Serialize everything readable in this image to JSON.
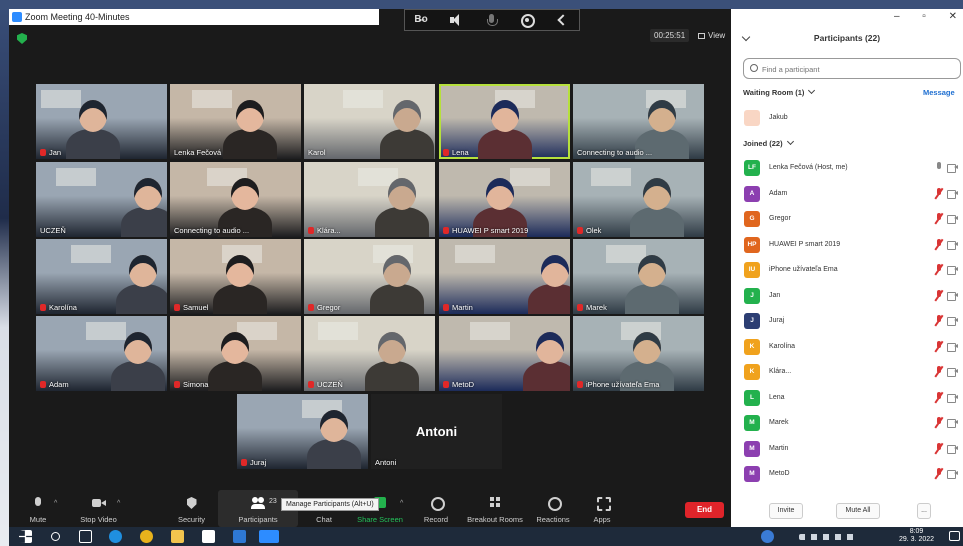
{
  "window": {
    "title": "Zoom Meeting 40-Minutes"
  },
  "meeting": {
    "timer": "00:25:51",
    "view_label": "View"
  },
  "audio_bar": {
    "items": [
      "Bo",
      "speaker",
      "mic",
      "broadcast",
      "back"
    ]
  },
  "tiles": [
    {
      "name": "Jan",
      "muted": true
    },
    {
      "name": "Lenka Fečová",
      "muted": false
    },
    {
      "name": "Karol",
      "muted": false
    },
    {
      "name": "Lena",
      "muted": true,
      "active": true
    },
    {
      "name": "Connecting to audio ...",
      "muted": false
    },
    {
      "name": "UCZEŇ",
      "muted": false
    },
    {
      "name": "Connecting to audio ...",
      "muted": false
    },
    {
      "name": "Klára...",
      "muted": true
    },
    {
      "name": "HUAWEI P smart 2019",
      "muted": true
    },
    {
      "name": "Olek",
      "muted": true
    },
    {
      "name": "Karolína",
      "muted": true
    },
    {
      "name": "Samuel",
      "muted": true
    },
    {
      "name": "Gregor",
      "muted": true
    },
    {
      "name": "Martin",
      "muted": true
    },
    {
      "name": "Marek",
      "muted": true
    },
    {
      "name": "Adam",
      "muted": true
    },
    {
      "name": "Simona",
      "muted": true
    },
    {
      "name": "UCZEŇ",
      "muted": true
    },
    {
      "name": "MetoD",
      "muted": true
    },
    {
      "name": "iPhone užívateľa Ema",
      "muted": true
    },
    {
      "name": "Juraj",
      "muted": true
    },
    {
      "name": "Antoni",
      "muted": false,
      "big": "Antoni"
    }
  ],
  "toolbar": {
    "mute": "Mute",
    "stop_video": "Stop Video",
    "security": "Security",
    "participants": "Participants",
    "participants_count": "23",
    "tooltip": "Manage Participants (Alt+U)",
    "chat": "Chat",
    "share_screen": "Share Screen",
    "record": "Record",
    "breakout": "Breakout Rooms",
    "reactions": "Reactions",
    "apps": "Apps",
    "end": "End"
  },
  "panel": {
    "title": "Participants (22)",
    "search_placeholder": "Find a participant",
    "waiting_header": "Waiting Room (1)",
    "message_link": "Message",
    "waiting": [
      {
        "name": "Jakub",
        "color": "#f9d6c4"
      }
    ],
    "joined_header": "Joined (22)",
    "joined": [
      {
        "initials": "LF",
        "name": "Lenka Fečová (Host, me)",
        "color": "#23b14d",
        "muted": false
      },
      {
        "initials": "A",
        "name": "Adam",
        "color": "#8c3fb0",
        "muted": true
      },
      {
        "initials": "G",
        "name": "Gregor",
        "color": "#e0661e",
        "muted": true
      },
      {
        "initials": "HP",
        "name": "HUAWEI P smart 2019",
        "color": "#e0661e",
        "muted": true
      },
      {
        "initials": "IU",
        "name": "iPhone užívateľa Ema",
        "color": "#f0a21d",
        "muted": true
      },
      {
        "initials": "J",
        "name": "Jan",
        "color": "#23b14d",
        "muted": true
      },
      {
        "initials": "J",
        "name": "Juraj",
        "color": "#2c3e73",
        "muted": true
      },
      {
        "initials": "K",
        "name": "Karolína",
        "color": "#f0a21d",
        "muted": true
      },
      {
        "initials": "K",
        "name": "Klára...",
        "color": "#f0a21d",
        "muted": true
      },
      {
        "initials": "L",
        "name": "Lena",
        "color": "#23b14d",
        "muted": true
      },
      {
        "initials": "M",
        "name": "Marek",
        "color": "#23b14d",
        "muted": true
      },
      {
        "initials": "M",
        "name": "Martin",
        "color": "#8c3fb0",
        "muted": true
      },
      {
        "initials": "M",
        "name": "MetoD",
        "color": "#8c3fb0",
        "muted": true
      }
    ],
    "invite": "Invite",
    "mute_all": "Mute All",
    "more": "..."
  },
  "taskbar": {
    "time": "8:09",
    "date": "29. 3. 2022"
  }
}
